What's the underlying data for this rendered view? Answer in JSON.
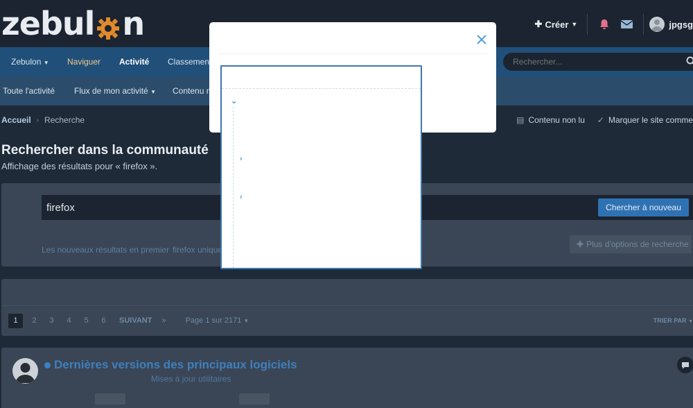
{
  "header": {
    "logo_text_a": "zebul",
    "logo_text_b": "n",
    "create_label": "Créer",
    "username": "jpgsg"
  },
  "nav_primary": {
    "items": [
      {
        "label": "Zebulon",
        "active": false
      },
      {
        "label": "Naviguer",
        "active": false
      },
      {
        "label": "Activité",
        "active": true
      },
      {
        "label": "Classement",
        "active": false
      }
    ],
    "search_placeholder": "Rechercher..."
  },
  "nav_secondary": {
    "items": [
      {
        "label": "Toute l'activité"
      },
      {
        "label": "Flux de mon activité"
      },
      {
        "label": "Contenu no"
      }
    ]
  },
  "breadcrumb": {
    "home": "Accueil",
    "current": "Recherche",
    "unread_label": "Contenu non lu",
    "mark_read_label": "Marquer le site comme"
  },
  "page": {
    "title": "Rechercher dans la communauté",
    "subtitle": "Affichage des résultats pour « firefox »."
  },
  "search_panel": {
    "query": "firefox",
    "search_again_label": "Chercher à nouveau",
    "option_newest": "Les nouveaux résultats en premier",
    "option_unique": "firefox unique",
    "more_options_label": "Plus d'options de recherche"
  },
  "pagination": {
    "pages": [
      "1",
      "2",
      "3",
      "4",
      "5",
      "6"
    ],
    "next_label": "SUIVANT",
    "last_label": "»",
    "page_info": "Page 1 sur 2171",
    "sort_label": "TRIER PAR"
  },
  "result": {
    "title": "Dernières versions des principaux logiciels",
    "subtitle": "Mises à jour utilitaires"
  },
  "colors": {
    "brand": "#20507a",
    "accent": "#2f72b3",
    "tree_chevron": "#4fa3d9",
    "logo_gear": "#e08a2c"
  }
}
